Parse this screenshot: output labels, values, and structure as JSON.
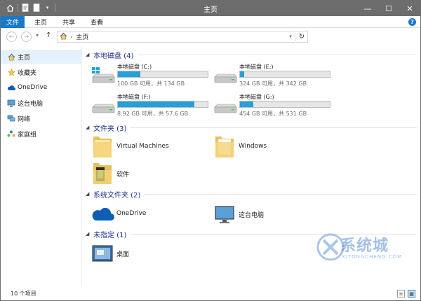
{
  "titlebar": {
    "title": "主页",
    "controls": {
      "minimize": "—",
      "maximize": "☐",
      "close": "✕"
    }
  },
  "ribbon": {
    "tabs": [
      {
        "label": "文件",
        "active": true
      },
      {
        "label": "主页"
      },
      {
        "label": "共享"
      },
      {
        "label": "查看"
      }
    ],
    "help": "?"
  },
  "nav": {
    "back": "←",
    "forward": "→",
    "recent": "▾",
    "up": "↑",
    "address": {
      "sep": "›",
      "location": "主页",
      "dropdown": "▾"
    },
    "refresh": "↻"
  },
  "sidebar": {
    "items": [
      {
        "label": "主页",
        "icon": "home-icon",
        "active": true
      },
      {
        "label": "收藏夹",
        "icon": "star-icon"
      },
      {
        "label": "OneDrive",
        "icon": "cloud-icon"
      },
      {
        "label": "这台电脑",
        "icon": "computer-icon"
      },
      {
        "label": "网络",
        "icon": "network-icon"
      },
      {
        "label": "家庭组",
        "icon": "homegroup-icon"
      }
    ]
  },
  "groups": {
    "drives": {
      "header": "本地磁盘 (4)",
      "items": [
        {
          "name": "本地磁盘 (C:)",
          "free": "100 GB 可用，共 134 GB",
          "used_fraction": 0.25,
          "windows": true
        },
        {
          "name": "本地磁盘 (E:)",
          "free": "324 GB 可用，共 342 GB",
          "used_fraction": 0.05
        },
        {
          "name": "本地磁盘 (F:)",
          "free": "8.92 GB 可用，共 57.6 GB",
          "used_fraction": 0.85
        },
        {
          "name": "本地磁盘 (G:)",
          "free": "454 GB 可用，共 531 GB",
          "used_fraction": 0.15
        }
      ]
    },
    "folders": {
      "header": "文件夹 (3)",
      "items": [
        {
          "label": "Virtual Machines",
          "icon": "folder-icon"
        },
        {
          "label": "Windows",
          "icon": "folder-icon"
        },
        {
          "label": "软件",
          "icon": "folder-icon"
        }
      ]
    },
    "system_folders": {
      "header": "系统文件夹 (2)",
      "items": [
        {
          "label": "OneDrive",
          "icon": "onedrive-icon"
        },
        {
          "label": "这台电脑",
          "icon": "computer-icon"
        }
      ]
    },
    "unassigned": {
      "header": "未指定 (1)",
      "items": [
        {
          "label": "桌面",
          "icon": "desktop-icon"
        }
      ]
    }
  },
  "status": {
    "count": "10 个项目"
  },
  "watermark": {
    "text": "系统城",
    "sub": "XITONGCHENG.COM"
  },
  "colors": {
    "accent": "#1979ca",
    "drive_bar": "#26a0da",
    "group_header": "#1e3287",
    "titlebar": "#6d6d6d"
  }
}
